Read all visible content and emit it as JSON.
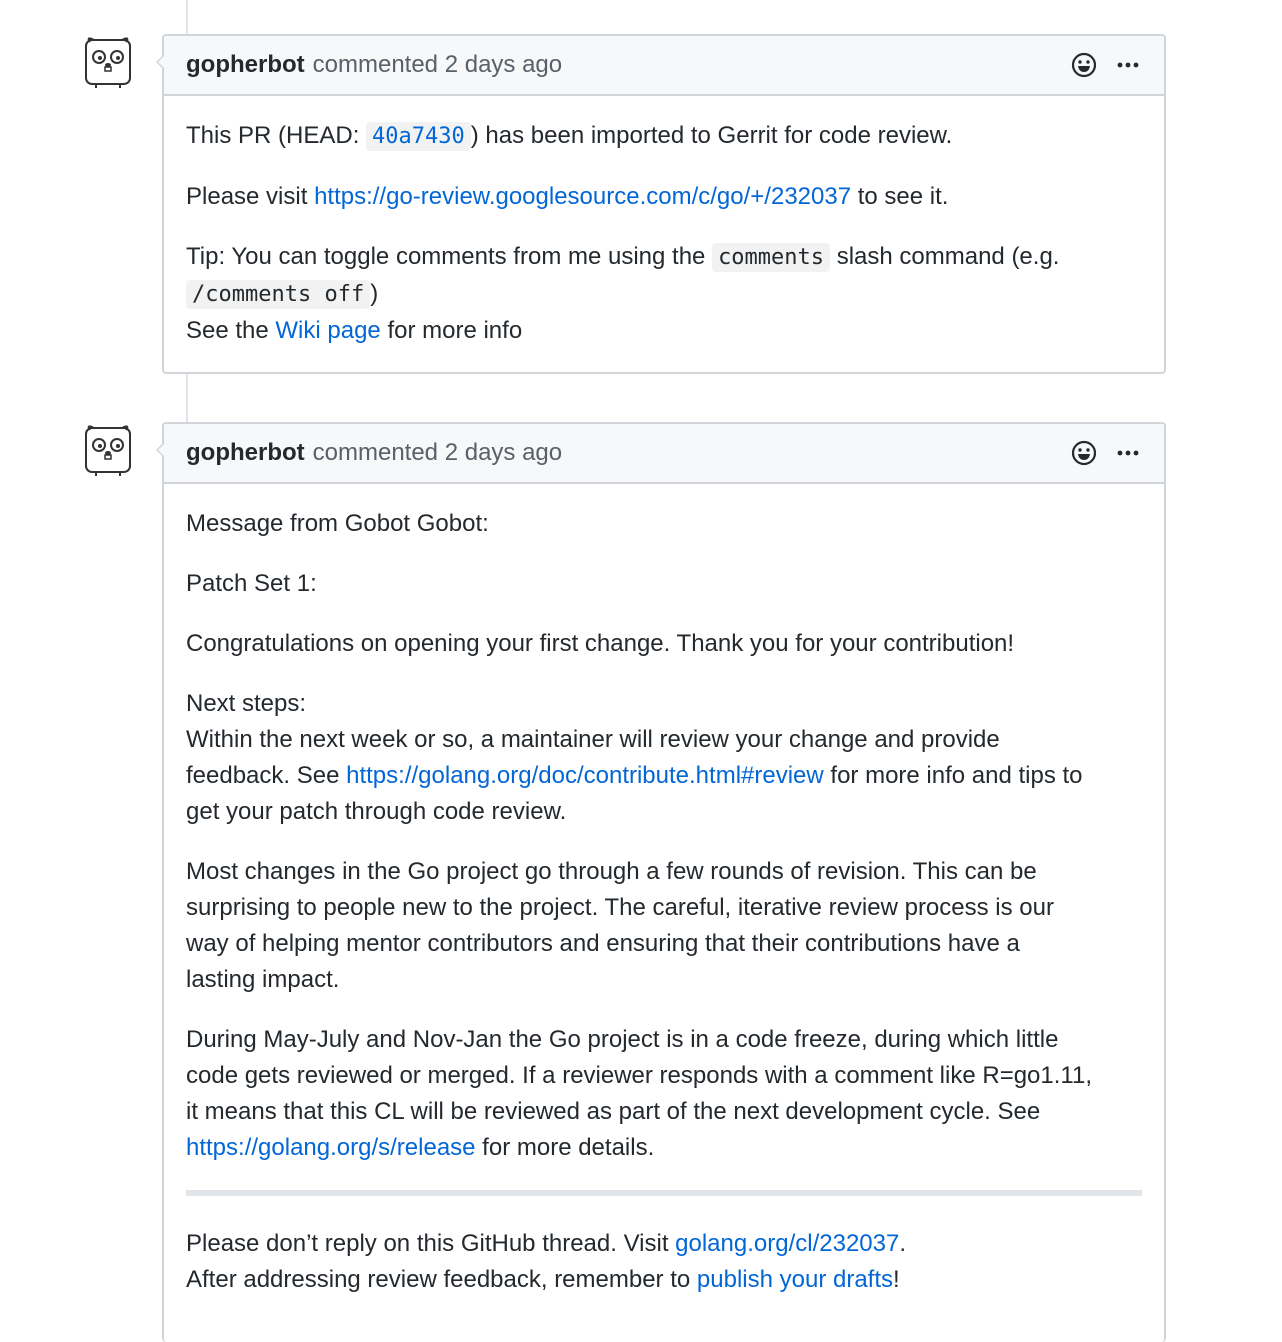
{
  "comments": [
    {
      "author": "gopherbot",
      "action": "commented",
      "time": "2 days ago",
      "pr_prefix": "This PR (HEAD: ",
      "sha": "40a7430",
      "pr_suffix": ") has been imported to Gerrit for code review.",
      "visit_prefix": "Please visit ",
      "visit_link": "https://go-review.googlesource.com/c/go/+/232037",
      "visit_suffix": " to see it.",
      "tip_prefix": "Tip: You can toggle comments from me using the ",
      "tip_code1": "comments",
      "tip_mid": " slash command (e.g.",
      "tip_code2": "/comments off",
      "tip_close": ")",
      "see_prefix": "See the ",
      "see_link": "Wiki page",
      "see_suffix": " for more info"
    },
    {
      "author": "gopherbot",
      "action": "commented",
      "time": "2 days ago",
      "line1": "Message from Gobot Gobot:",
      "line2": "Patch Set 1:",
      "line3": "Congratulations on opening your first change. Thank you for your contribution!",
      "next_title": "Next steps:",
      "next_prefix": "Within the next week or so, a maintainer will review your change and provide feedback. See ",
      "next_link": "https://golang.org/doc/contribute.html#review",
      "next_suffix": " for more info and tips to get your patch through code review.",
      "most_changes": "Most changes in the Go project go through a few rounds of revision. This can be surprising to people new to the project. The careful, iterative review process is our way of helping mentor contributors and ensuring that their contributions have a lasting impact.",
      "freeze_prefix": "During May-July and Nov-Jan the Go project is in a code freeze, during which little code gets reviewed or merged. If a reviewer responds with a comment like R=go1.11, it means that this CL will be reviewed as part of the next development cycle. See ",
      "freeze_link": "https://golang.org/s/release",
      "freeze_suffix": " for more details.",
      "reply_prefix": "Please don’t reply on this GitHub thread. Visit ",
      "reply_link": "golang.org/cl/232037",
      "reply_suffix": ".",
      "after_prefix": "After addressing review feedback, remember to ",
      "after_link": "publish your drafts",
      "after_suffix": "!"
    }
  ]
}
